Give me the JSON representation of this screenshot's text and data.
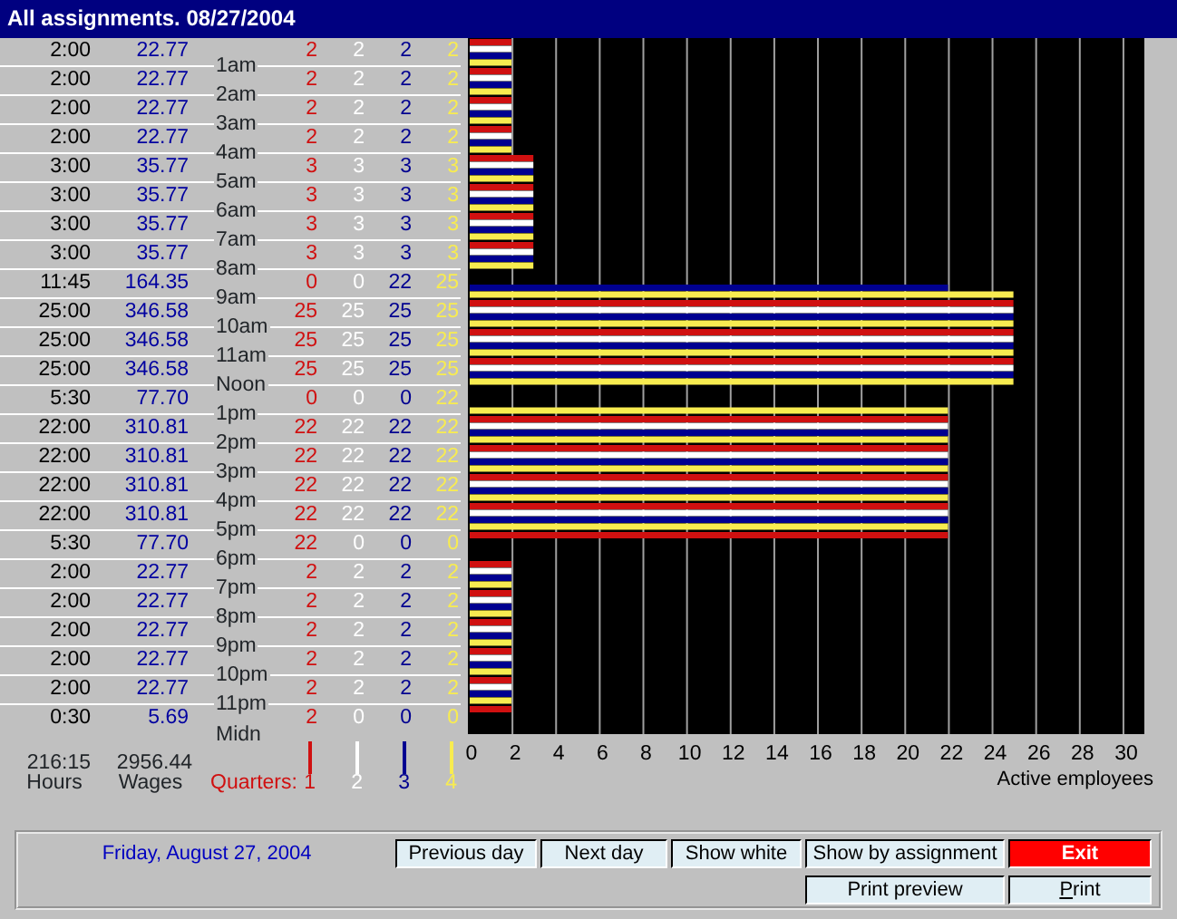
{
  "window": {
    "title": "All assignments. 08/27/2004"
  },
  "rows": [
    {
      "hours": "2:00",
      "wages": "22.77",
      "quarters": [
        "2",
        "2",
        "2",
        "2"
      ]
    },
    {
      "hours": "2:00",
      "wages": "22.77",
      "quarters": [
        "2",
        "2",
        "2",
        "2"
      ]
    },
    {
      "hours": "2:00",
      "wages": "22.77",
      "quarters": [
        "2",
        "2",
        "2",
        "2"
      ]
    },
    {
      "hours": "2:00",
      "wages": "22.77",
      "quarters": [
        "2",
        "2",
        "2",
        "2"
      ]
    },
    {
      "hours": "3:00",
      "wages": "35.77",
      "quarters": [
        "3",
        "3",
        "3",
        "3"
      ]
    },
    {
      "hours": "3:00",
      "wages": "35.77",
      "quarters": [
        "3",
        "3",
        "3",
        "3"
      ]
    },
    {
      "hours": "3:00",
      "wages": "35.77",
      "quarters": [
        "3",
        "3",
        "3",
        "3"
      ]
    },
    {
      "hours": "3:00",
      "wages": "35.77",
      "quarters": [
        "3",
        "3",
        "3",
        "3"
      ]
    },
    {
      "hours": "11:45",
      "wages": "164.35",
      "quarters": [
        "0",
        "0",
        "22",
        "25"
      ]
    },
    {
      "hours": "25:00",
      "wages": "346.58",
      "quarters": [
        "25",
        "25",
        "25",
        "25"
      ]
    },
    {
      "hours": "25:00",
      "wages": "346.58",
      "quarters": [
        "25",
        "25",
        "25",
        "25"
      ]
    },
    {
      "hours": "25:00",
      "wages": "346.58",
      "quarters": [
        "25",
        "25",
        "25",
        "25"
      ]
    },
    {
      "hours": "5:30",
      "wages": "77.70",
      "quarters": [
        "0",
        "0",
        "0",
        "22"
      ]
    },
    {
      "hours": "22:00",
      "wages": "310.81",
      "quarters": [
        "22",
        "22",
        "22",
        "22"
      ]
    },
    {
      "hours": "22:00",
      "wages": "310.81",
      "quarters": [
        "22",
        "22",
        "22",
        "22"
      ]
    },
    {
      "hours": "22:00",
      "wages": "310.81",
      "quarters": [
        "22",
        "22",
        "22",
        "22"
      ]
    },
    {
      "hours": "22:00",
      "wages": "310.81",
      "quarters": [
        "22",
        "22",
        "22",
        "22"
      ]
    },
    {
      "hours": "5:30",
      "wages": "77.70",
      "quarters": [
        "22",
        "0",
        "0",
        "0"
      ]
    },
    {
      "hours": "2:00",
      "wages": "22.77",
      "quarters": [
        "2",
        "2",
        "2",
        "2"
      ]
    },
    {
      "hours": "2:00",
      "wages": "22.77",
      "quarters": [
        "2",
        "2",
        "2",
        "2"
      ]
    },
    {
      "hours": "2:00",
      "wages": "22.77",
      "quarters": [
        "2",
        "2",
        "2",
        "2"
      ]
    },
    {
      "hours": "2:00",
      "wages": "22.77",
      "quarters": [
        "2",
        "2",
        "2",
        "2"
      ]
    },
    {
      "hours": "2:00",
      "wages": "22.77",
      "quarters": [
        "2",
        "2",
        "2",
        "2"
      ]
    },
    {
      "hours": "0:30",
      "wages": "5.69",
      "quarters": [
        "2",
        "0",
        "0",
        "0"
      ]
    }
  ],
  "totals": {
    "hours": "216:15",
    "hours_label": "Hours",
    "wages": "2956.44",
    "wages_label": "Wages"
  },
  "hour_marks": [
    "1am",
    "2am",
    "3am",
    "4am",
    "5am",
    "6am",
    "7am",
    "8am",
    "9am",
    "10am",
    "11am",
    "Noon",
    "1pm",
    "2pm",
    "3pm",
    "4pm",
    "5pm",
    "6pm",
    "7pm",
    "8pm",
    "9pm",
    "10pm",
    "11pm",
    "Midn"
  ],
  "legend": {
    "label": "Quarters:"
  },
  "chart_data": {
    "type": "bar",
    "orientation": "horizontal",
    "xlabel": "Active employees",
    "xlim": [
      0,
      31
    ],
    "xticks": [
      0,
      2,
      4,
      6,
      8,
      10,
      12,
      14,
      16,
      18,
      20,
      22,
      24,
      26,
      28,
      30
    ],
    "grid": true,
    "series": [
      {
        "name": "1",
        "color": "#d01010",
        "values": [
          2,
          2,
          2,
          2,
          3,
          3,
          3,
          3,
          0,
          25,
          25,
          25,
          0,
          22,
          22,
          22,
          22,
          22,
          2,
          2,
          2,
          2,
          2,
          2
        ]
      },
      {
        "name": "2",
        "color": "#ffffff",
        "values": [
          2,
          2,
          2,
          2,
          3,
          3,
          3,
          3,
          0,
          25,
          25,
          25,
          0,
          22,
          22,
          22,
          22,
          0,
          2,
          2,
          2,
          2,
          2,
          0
        ]
      },
      {
        "name": "3",
        "color": "#000090",
        "values": [
          2,
          2,
          2,
          2,
          3,
          3,
          3,
          3,
          22,
          25,
          25,
          25,
          0,
          22,
          22,
          22,
          22,
          0,
          2,
          2,
          2,
          2,
          2,
          0
        ]
      },
      {
        "name": "4",
        "color": "#f8ec50",
        "values": [
          2,
          2,
          2,
          2,
          3,
          3,
          3,
          3,
          25,
          25,
          25,
          25,
          22,
          22,
          22,
          22,
          22,
          0,
          2,
          2,
          2,
          2,
          2,
          0
        ]
      }
    ]
  },
  "status": {
    "date": "Friday, August 27, 2004"
  },
  "buttons": [
    [
      {
        "label": "Previous day",
        "kind": "normal",
        "underline_first": false
      },
      {
        "label": "Next day",
        "kind": "normal",
        "underline_first": false
      },
      {
        "label": "Show white",
        "kind": "normal",
        "underline_first": false
      },
      {
        "label": "Show by assignment",
        "kind": "normal",
        "underline_first": false
      },
      {
        "label": "Exit",
        "kind": "danger",
        "underline_first": false
      }
    ],
    [
      {
        "label": "Print preview",
        "kind": "normal",
        "underline_first": false
      },
      {
        "label": "Print",
        "kind": "normal",
        "underline_first": true
      }
    ]
  ]
}
